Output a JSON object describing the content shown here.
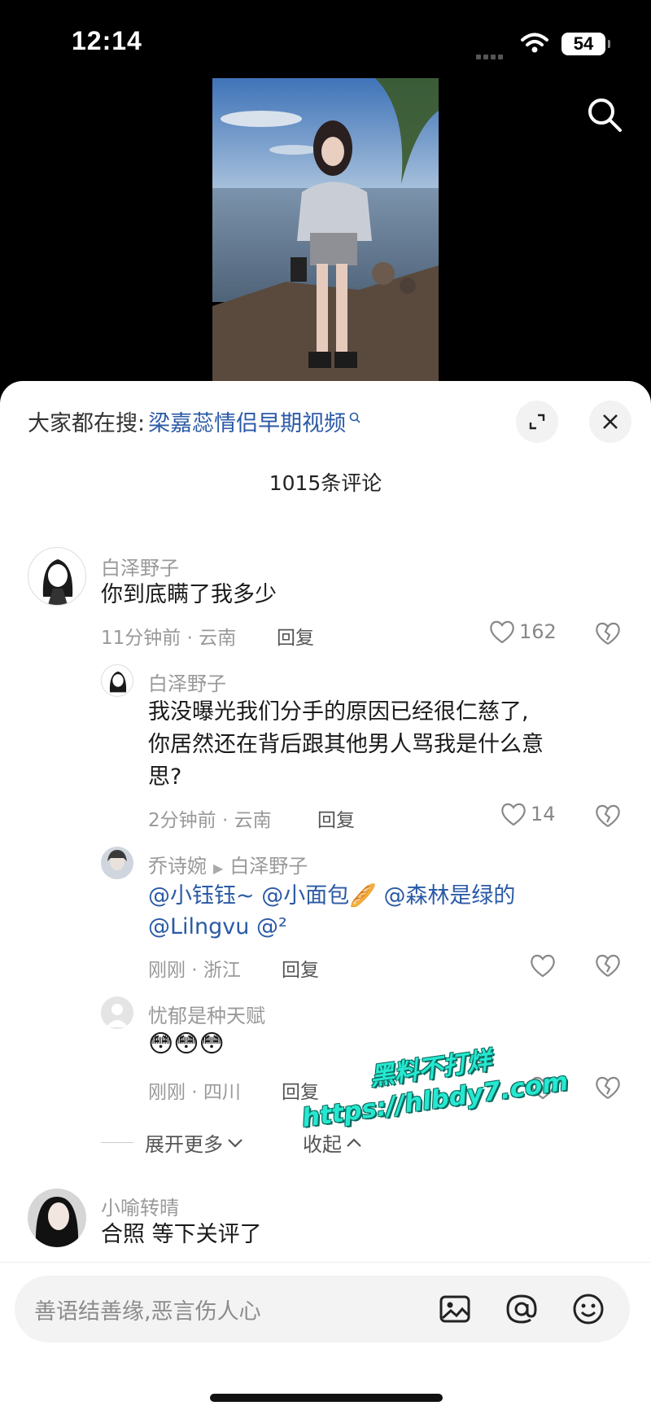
{
  "status_bar": {
    "time": "12:14",
    "battery": "54"
  },
  "sheet": {
    "trending_prefix": "大家都在搜:",
    "trending_query": "梁嘉蕊情侣早期视频",
    "comment_count": "1015条评论"
  },
  "comments": [
    {
      "name": "白泽野子",
      "text": "你到底瞒了我多少",
      "meta": "11分钟前 · 云南",
      "reply_label": "回复",
      "likes": "162"
    },
    {
      "name": "白泽野子",
      "text_lines": [
        "我没曝光我们分手的原因已经很仁慈了,",
        "你居然还在背后跟其他男人骂我是什么意",
        "思?"
      ],
      "meta": "2分钟前 · 云南",
      "reply_label": "回复",
      "likes": "14"
    },
    {
      "name": "乔诗婉",
      "reply_to": "白泽野子",
      "mentions_line1": [
        "@小钰钰~",
        "@小面包🥖",
        "@森林是绿的"
      ],
      "mentions_line2": [
        "@Lilngvu",
        "@²"
      ],
      "meta": "刚刚 · 浙江",
      "reply_label": "回复"
    },
    {
      "name": "忧郁是种天赋",
      "text": "😳😳😳",
      "meta": "刚刚 · 四川",
      "reply_label": "回复"
    },
    {
      "name": "小喻转晴",
      "text": "合照 等下关评了"
    }
  ],
  "expand": {
    "more_label": "展开更多",
    "collapse_label": "收起"
  },
  "watermark": {
    "line1": "黑料不打烊",
    "line2": "https://hlbdy7.com"
  },
  "input": {
    "placeholder": "善语结善缘,恶言伤人心"
  }
}
